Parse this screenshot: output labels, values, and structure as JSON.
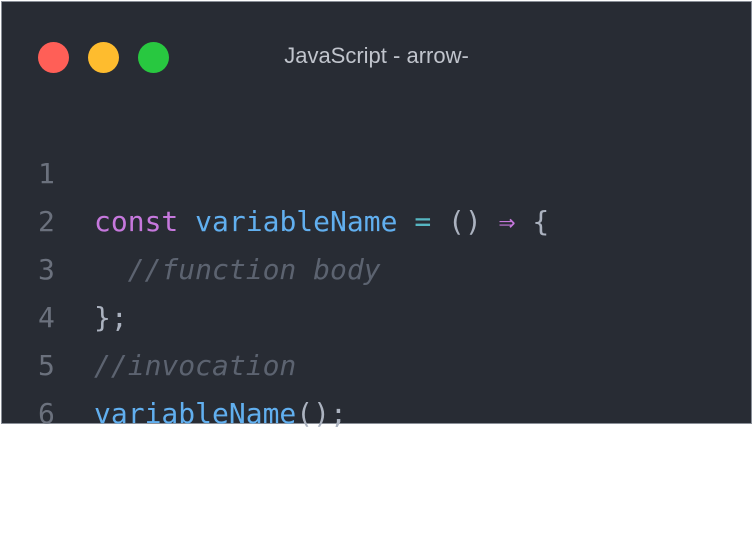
{
  "window": {
    "title": "JavaScript - arrow-",
    "controls": {
      "close": {
        "name": "close",
        "color": "#ff5f57"
      },
      "minimize": {
        "name": "minimize",
        "color": "#febc2e"
      },
      "maximize": {
        "name": "maximize",
        "color": "#28c840"
      }
    }
  },
  "editor": {
    "lines": [
      {
        "number": "1",
        "tokens": {
          "t1": "const",
          "t2": " ",
          "t3": "variableName",
          "t4": " ",
          "t5": "=",
          "t6": " ",
          "t7": "()",
          "t8": " ",
          "t9": "⇒",
          "t10": " ",
          "t11": "{"
        }
      },
      {
        "number": "2",
        "indent": "  ",
        "comment": "//function body"
      },
      {
        "number": "3",
        "text": "};"
      },
      {
        "number": "4",
        "comment": "//invocation"
      },
      {
        "number": "5",
        "call": "variableName",
        "rest": "();"
      },
      {
        "number": "6"
      }
    ]
  },
  "colors": {
    "background": "#282c34",
    "keyword": "#c678dd",
    "function": "#61afef",
    "operator": "#56b6c2",
    "comment": "#5c6370",
    "punctuation": "#abb2bf",
    "line_number": "#6b717d"
  }
}
